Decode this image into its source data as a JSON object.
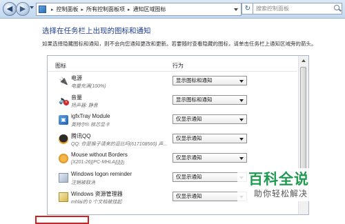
{
  "address_bar": {
    "back_glyph": "◀",
    "forward_glyph": "▶",
    "breadcrumb": [
      "控制面板",
      "所有控制面板项",
      "通知区域图标"
    ],
    "separator": "▸",
    "refresh_glyph": "↻",
    "search_placeholder": "搜索控制面板"
  },
  "page": {
    "title": "选择在任务栏上出现的图标和通知",
    "description": "如果选择隐藏图标和通知，则不会向您通知更改和更新。若要随时查看隐藏的图标，请单击任务栏上通知区域旁的箭头。"
  },
  "table": {
    "headers": {
      "icon": "图标",
      "behavior": "行为"
    },
    "rows": [
      {
        "icon": "power-icon",
        "glyph": "🔌",
        "name": "电源",
        "desc": "电量充满(100%)",
        "behavior": "显示图标和通知"
      },
      {
        "icon": "volume-icon",
        "glyph": "🔈",
        "name": "音量",
        "desc": "扬声器: 静音",
        "behavior": "显示图标和通知"
      },
      {
        "icon": "intel-graphics-icon",
        "glyph": "▣",
        "name": "igfxTray Module",
        "desc": "英特尔® 核芯显卡",
        "behavior": "仅显示通知"
      },
      {
        "icon": "qq-icon",
        "glyph": "",
        "name": "腾讯QQ",
        "desc": "QQ: 你是猴子请来的逗比吗(617108560)  声...",
        "behavior": "仅显示通知"
      },
      {
        "icon": "mouse-without-borders-icon",
        "glyph": "",
        "name": "Mouse without Borders",
        "desc": "[X201-26][PC-MHLA][][][]",
        "behavior": "仅显示通知"
      },
      {
        "icon": "windows-logon-reminder-icon",
        "glyph": "",
        "name": "Windows logon reminder",
        "desc": "注销被取消",
        "behavior": "仅显示通知"
      },
      {
        "icon": "windows-explorer-icon",
        "glyph": "",
        "name": "Windows 资源管理器",
        "desc": "mhlai的 0 个文档被挂起",
        "behavior": "仅显示通知"
      }
    ]
  },
  "watermark": {
    "main": "百科全说",
    "sub": "助你轻松解决"
  }
}
